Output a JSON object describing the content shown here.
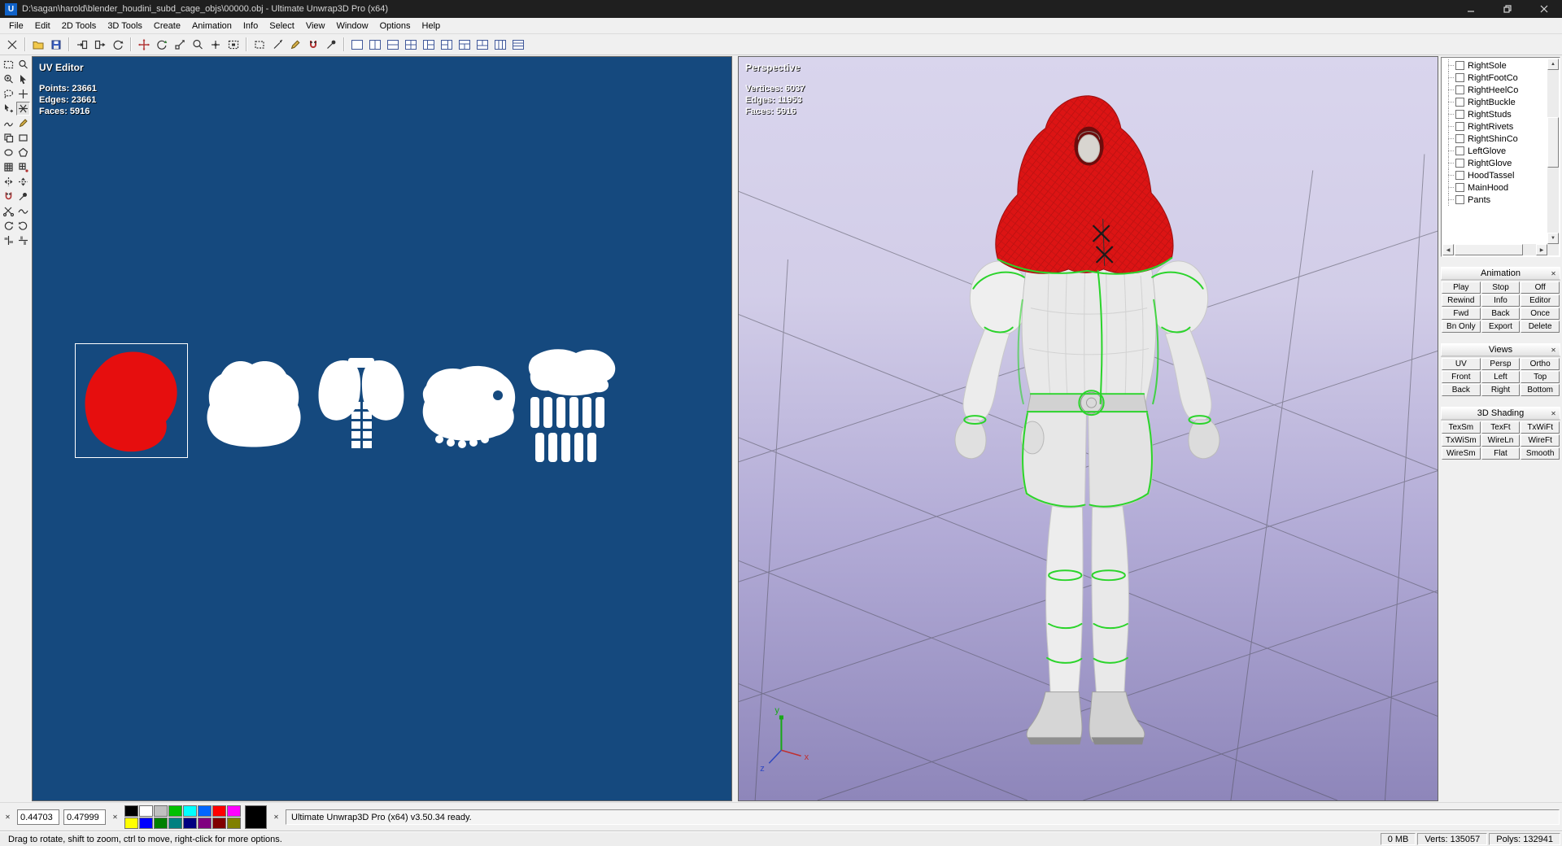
{
  "colors": {
    "titlebar": "#1F1F1F",
    "uv-bg": "#15497E",
    "selected-island": "#E60E0E",
    "island": "#FFFFFF",
    "seam": "#2BD42B",
    "hood": "#DC1414",
    "vp-top": "#D9D5ED",
    "vp-bottom": "#8E86BA"
  },
  "titlebar": {
    "app_initial": "U",
    "title": "D:\\sagan\\harold\\blender_houdini_subd_cage_objs\\00000.obj - Ultimate Unwrap3D Pro (x64)"
  },
  "menu": {
    "items": [
      "File",
      "Edit",
      "2D Tools",
      "3D Tools",
      "Create",
      "Animation",
      "Info",
      "Select",
      "View",
      "Window",
      "Options",
      "Help"
    ]
  },
  "uv_editor": {
    "title": "UV Editor",
    "points": "Points: 23661",
    "edges": "Edges: 23661",
    "faces": "Faces: 5916"
  },
  "viewport": {
    "title": "Perspective",
    "vertices": "Vertices: 6037",
    "edges": "Edges: 11953",
    "faces": "Faces: 5916",
    "axis": {
      "x": "x",
      "y": "y",
      "z": "z"
    }
  },
  "tree": {
    "items": [
      "RightSole",
      "RightFootCo",
      "RightHeelCo",
      "RightBuckle",
      "RightStuds",
      "RightRivets",
      "RightShinCo",
      "LeftGlove",
      "RightGlove",
      "HoodTassel",
      "MainHood",
      "Pants"
    ]
  },
  "panels": {
    "animation": {
      "title": "Animation",
      "buttons": [
        "Play",
        "Stop",
        "Off",
        "Rewind",
        "Info",
        "Editor",
        "Fwd",
        "Back",
        "Once",
        "Bn Only",
        "Export",
        "Delete"
      ]
    },
    "views": {
      "title": "Views",
      "buttons": [
        "UV",
        "Persp",
        "Ortho",
        "Front",
        "Left",
        "Top",
        "Back",
        "Right",
        "Bottom"
      ]
    },
    "shading": {
      "title": "3D Shading",
      "buttons": [
        "TexSm",
        "TexFt",
        "TxWiFt",
        "TxWiSm",
        "WireLn",
        "WireFt",
        "WireSm",
        "Flat",
        "Smooth"
      ]
    }
  },
  "bottom": {
    "coord_u": "0.44703",
    "coord_v": "0.47999",
    "status": "Ultimate Unwrap3D Pro (x64) v3.50.34 ready.",
    "palette_row1": [
      "#000000",
      "#FFFFFF",
      "#C0C0C0",
      "#00C000",
      "#00FFFF",
      "#0066FF",
      "#FF0000",
      "#FF00FF"
    ],
    "palette_row2": [
      "#FFFF00",
      "#0000FF",
      "#008000",
      "#008080",
      "#000080",
      "#800080",
      "#800000",
      "#808000"
    ],
    "current_color": "#000000"
  },
  "statusbar": {
    "hint": "Drag to rotate, shift to zoom, ctrl to move, right-click for more options.",
    "memory": "0 MB",
    "verts": "Verts: 135057",
    "polys": "Polys: 132941"
  },
  "icons": {
    "glyphs": {
      "close": "✕",
      "up": "▲",
      "down": "▼",
      "left": "◀",
      "right": "▶"
    },
    "toolbar": [
      "new",
      "open",
      "save",
      "import",
      "export",
      "refresh",
      "move",
      "rotate",
      "scale",
      "zoom",
      "pan",
      "fit",
      "select-rect",
      "magic-wand",
      "pen",
      "magnet",
      "eyedropper",
      "layout-single",
      "layout-vsplit",
      "layout-hsplit",
      "layout-quad",
      "layout-left-split",
      "layout-right-split",
      "layout-top-split",
      "layout-bottom-split",
      "layout-three-columns",
      "layout-three-rows",
      "layout-wide"
    ],
    "side_tools": [
      "select-rect",
      "zoom",
      "zoom-region",
      "select-arrow",
      "lasso",
      "move-cross",
      "add-vertex",
      "weld",
      "stitch",
      "pen",
      "clone",
      "rect-tool",
      "ellipse-tool",
      "polygon-tool",
      "grid",
      "snap-grid",
      "mirror-horizontal",
      "mirror-vertical",
      "magnet",
      "pin",
      "cut",
      "relax",
      "rotate-ccw",
      "rotate-cw",
      "align-horizontal",
      "align-vertical"
    ]
  }
}
